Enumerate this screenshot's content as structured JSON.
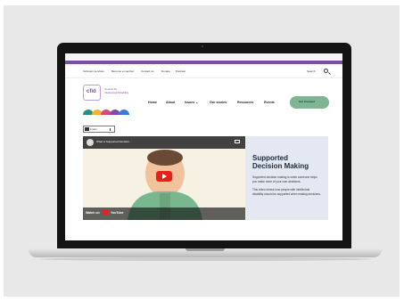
{
  "utility_nav": [
    "Inclusion services",
    "Become a member",
    "Contact us",
    "Donate",
    "Podcast"
  ],
  "search_label": "Search",
  "logo": {
    "text_line1": "Council for",
    "text_line2": "Intellectual Disability",
    "mark": "cfid"
  },
  "main_nav": [
    "Home",
    "About",
    "Issues ⌄",
    "Our stories",
    "Resources",
    "Events"
  ],
  "cta_label": "Get involved",
  "language_selector": "Listen",
  "video": {
    "title": "What is Supported Decision...",
    "watch_on": "Watch on",
    "brand": "YouTube"
  },
  "panel": {
    "title_line1": "Supported",
    "title_line2": "Decision Making",
    "para1": "Supported decision making is when someone helps you make more of your own decisions.",
    "para2": "This video shows how people with intellectual disability should be supported when making decisions."
  },
  "colors": {
    "accent": "#7a4fa0",
    "cta": "#7fb495",
    "panel": "#e3e8f2",
    "youtube_red": "#e62117"
  }
}
